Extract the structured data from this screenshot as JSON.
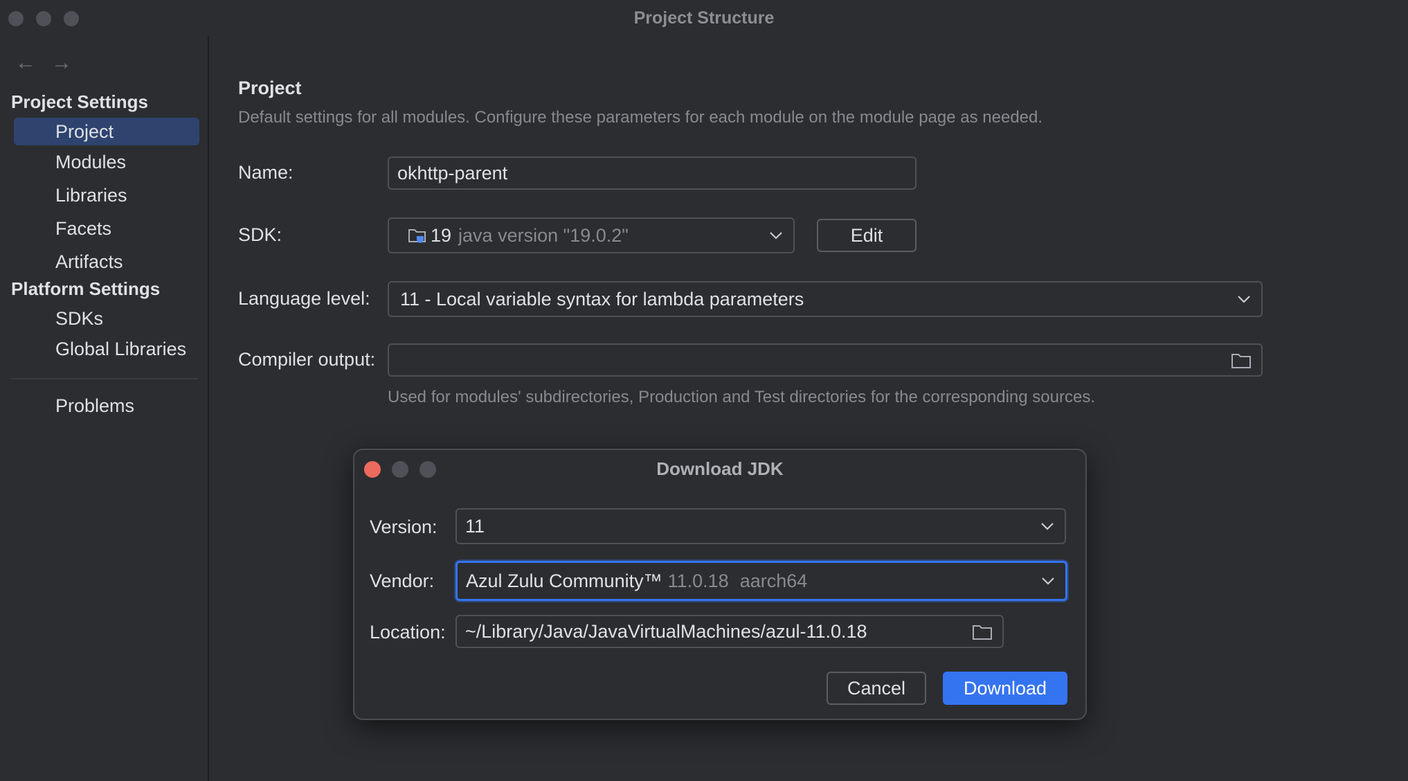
{
  "window": {
    "title": "Project Structure"
  },
  "nav": {
    "back": "←",
    "forward": "→"
  },
  "sidebar": {
    "project_settings_header": "Project Settings",
    "platform_settings_header": "Platform Settings",
    "items": [
      {
        "label": "Project",
        "selected": true
      },
      {
        "label": "Modules"
      },
      {
        "label": "Libraries"
      },
      {
        "label": "Facets"
      },
      {
        "label": "Artifacts"
      },
      {
        "label": "SDKs"
      },
      {
        "label": "Global Libraries"
      },
      {
        "label": "Problems"
      }
    ]
  },
  "project": {
    "title": "Project",
    "description": "Default settings for all modules. Configure these parameters for each module on the module page as needed.",
    "name_label": "Name:",
    "name_value": "okhttp-parent",
    "sdk_label": "SDK:",
    "sdk_version": "19",
    "sdk_detail": "java version \"19.0.2\"",
    "edit_label": "Edit",
    "language_level_label": "Language level:",
    "language_level_value": "11 - Local variable syntax for lambda parameters",
    "compiler_output_label": "Compiler output:",
    "compiler_output_value": "",
    "compiler_hint": "Used for modules' subdirectories, Production and Test directories for the corresponding sources."
  },
  "dialog": {
    "title": "Download JDK",
    "version_label": "Version:",
    "version_value": "11",
    "vendor_label": "Vendor:",
    "vendor_value": "Azul Zulu Community™",
    "vendor_version": "11.0.18",
    "vendor_arch": "aarch64",
    "location_label": "Location:",
    "location_value": "~/Library/Java/JavaVirtualMachines/azul-11.0.18",
    "cancel_label": "Cancel",
    "download_label": "Download"
  },
  "colors": {
    "accent": "#3574f0",
    "selection": "#2e436e",
    "close": "#ed6a5e"
  }
}
